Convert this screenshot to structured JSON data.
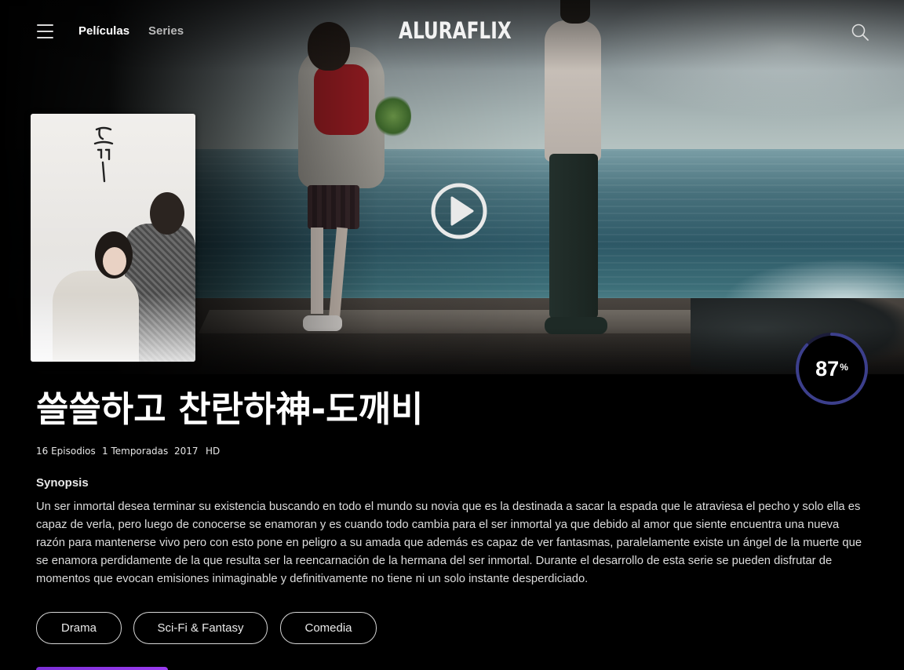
{
  "nav": {
    "links": [
      {
        "label": "Películas",
        "active": true
      },
      {
        "label": "Series",
        "active": false
      }
    ],
    "logo": "ALURAFLIX",
    "menu_icon": "hamburger-menu-icon",
    "search_icon": "search-icon"
  },
  "hero": {
    "play_icon": "play-icon"
  },
  "poster": {
    "calligraphy": "도깨비"
  },
  "show": {
    "title": "쓸쓸하고 찬란하神-도깨비",
    "rating": {
      "value": "87",
      "unit": "%",
      "fraction": 0.87
    },
    "meta": {
      "episodes": "16 Episodios",
      "seasons": "1 Temporadas",
      "year": "2017",
      "quality": "HD"
    },
    "synopsis_heading": "Synopsis",
    "synopsis": "Un ser inmortal desea terminar su existencia buscando en todo el mundo su novia que es la destinada a sacar la espada que le atraviesa el pecho y solo ella es capaz de verla, pero luego de conocerse se enamoran y es cuando todo cambia para el ser inmortal ya que debido al amor que siente encuentra una nueva razón para mantenerse vivo pero con esto pone en peligro a su amada que además es capaz de ver fantasmas, paralelamente existe un ángel de la muerte que se enamora perdidamente de la que resulta ser la reencarnación de la hermana del ser inmortal. Durante el desarrollo de esta serie se pueden disfrutar de momentos que evocan emisiones inimaginable y definitivamente no tiene ni un solo instante desperdiciado.",
    "genres": [
      "Drama",
      "Sci-Fi & Fantasy",
      "Comedia"
    ]
  },
  "colors": {
    "background": "#000000",
    "rating_ring": "#3c3f8c",
    "rating_track": "#1c1d3a",
    "accent": "#8a35e4"
  }
}
